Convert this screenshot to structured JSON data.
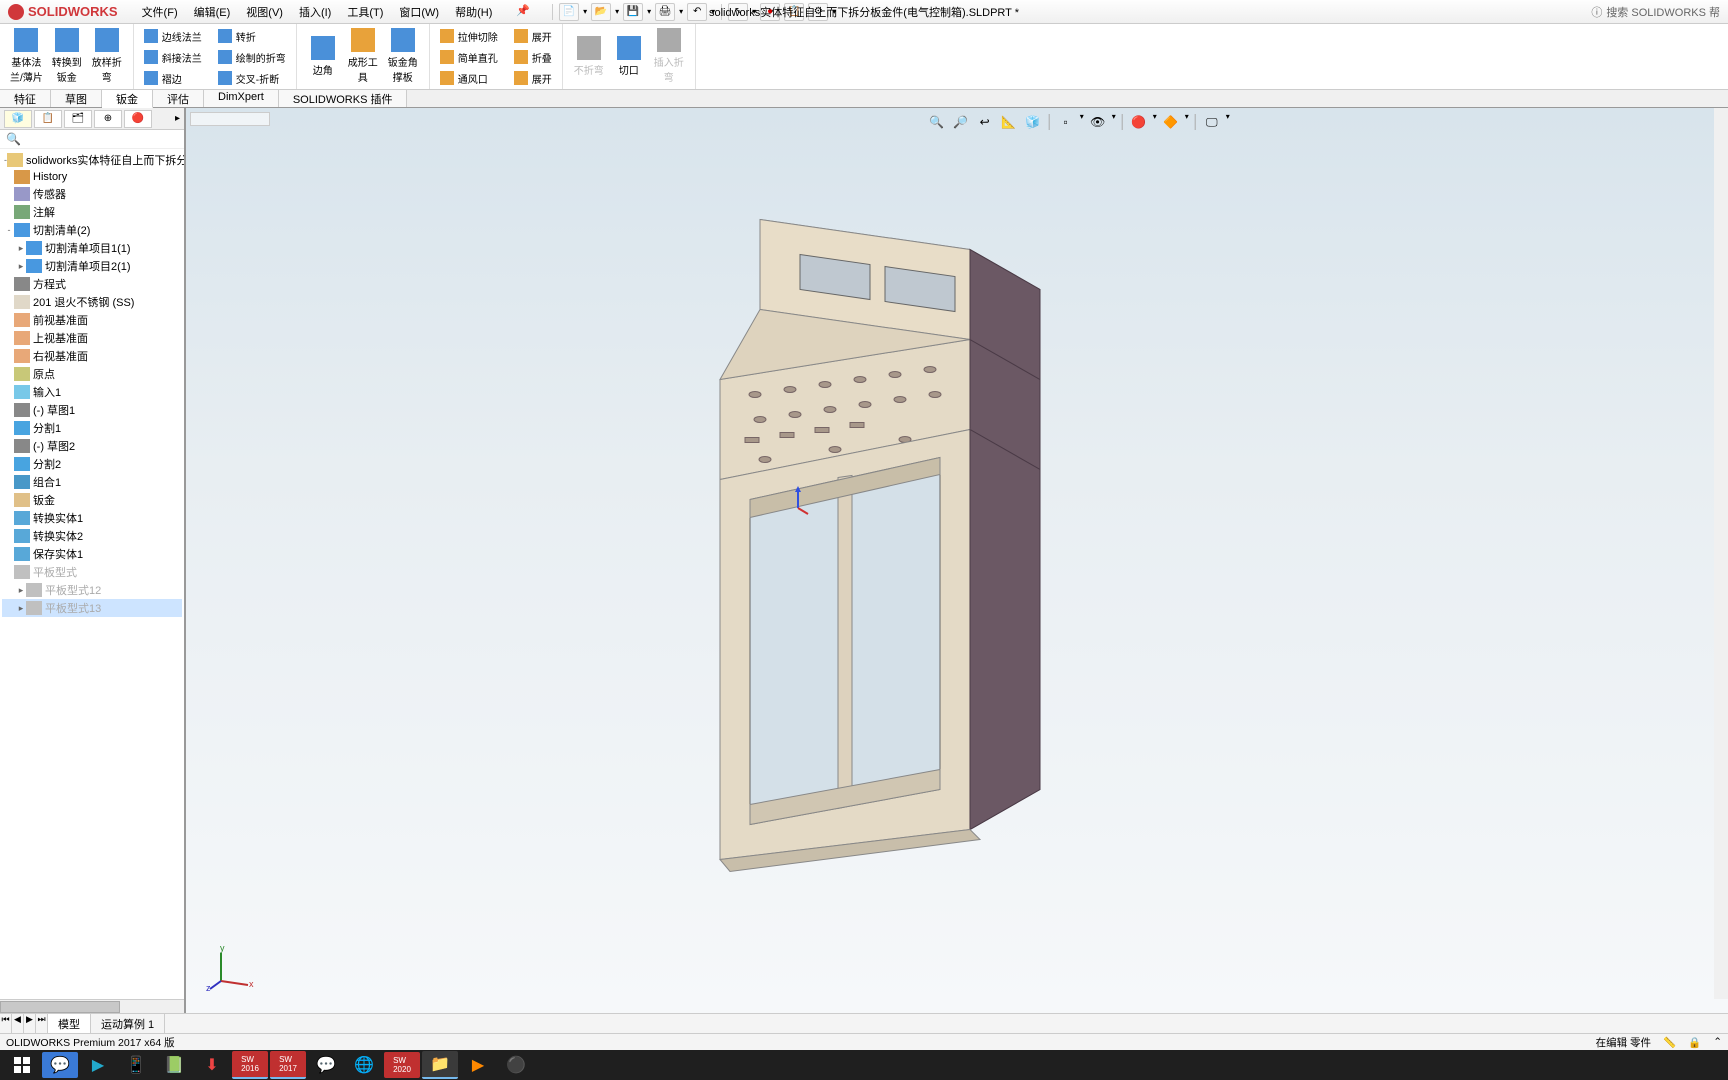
{
  "app": {
    "logo": "SOLIDWORKS",
    "doc_title": "solidworks实体特征自上而下拆分板金件(电气控制箱).SLDPRT *",
    "search_placeholder": "搜索 SOLIDWORKS 帮"
  },
  "menu": [
    "文件(F)",
    "编辑(E)",
    "视图(V)",
    "插入(I)",
    "工具(T)",
    "窗口(W)",
    "帮助(H)"
  ],
  "ribbon": {
    "large": [
      {
        "label": "基体法\n兰/薄片"
      },
      {
        "label": "转换到\n钣金"
      },
      {
        "label": "放样折\n弯"
      }
    ],
    "col1": [
      "边线法兰",
      "斜接法兰",
      "褶边"
    ],
    "col2": [
      "转折",
      "绘制的折弯",
      "交叉-折断"
    ],
    "large2": [
      {
        "label": "边角"
      },
      {
        "label": "成形工\n具"
      },
      {
        "label": "钣金角\n撑板"
      }
    ],
    "col3": [
      "拉伸切除",
      "简单直孔",
      "通风口"
    ],
    "col4": [
      "展开",
      "折叠",
      "展开"
    ],
    "large3": [
      {
        "label": "不折弯"
      },
      {
        "label": "切口"
      },
      {
        "label": "插入折\n弯"
      }
    ]
  },
  "tabs": [
    "特征",
    "草图",
    "钣金",
    "评估",
    "DimXpert",
    "SOLIDWORKS 插件"
  ],
  "tree": {
    "root": "solidworks实体特征自上而下拆分板金件",
    "items": [
      {
        "t": "History",
        "ico": "ico-hist"
      },
      {
        "t": "传感器",
        "ico": "ico-sensor"
      },
      {
        "t": "注解",
        "ico": "ico-anno"
      },
      {
        "t": "切割清单(2)",
        "ico": "ico-cutlist",
        "exp": "-"
      },
      {
        "t": "切割清单项目1(1)",
        "ico": "ico-cutlist",
        "indent": 1,
        "exp": "▸"
      },
      {
        "t": "切割清单项目2(1)",
        "ico": "ico-cutlist",
        "indent": 1,
        "exp": "▸"
      },
      {
        "t": "方程式",
        "ico": "ico-eq"
      },
      {
        "t": "201 退火不锈钢 (SS)",
        "ico": "ico-mat"
      },
      {
        "t": "前视基准面",
        "ico": "ico-plane"
      },
      {
        "t": "上视基准面",
        "ico": "ico-plane"
      },
      {
        "t": "右视基准面",
        "ico": "ico-plane"
      },
      {
        "t": "原点",
        "ico": "ico-origin"
      },
      {
        "t": "输入1",
        "ico": "ico-import"
      },
      {
        "t": "(-) 草图1",
        "ico": "ico-sketch"
      },
      {
        "t": "分割1",
        "ico": "ico-split"
      },
      {
        "t": "(-) 草图2",
        "ico": "ico-sketch"
      },
      {
        "t": "分割2",
        "ico": "ico-split"
      },
      {
        "t": "组合1",
        "ico": "ico-combine"
      },
      {
        "t": "钣金",
        "ico": "ico-sm"
      },
      {
        "t": "转换实体1",
        "ico": "ico-conv"
      },
      {
        "t": "转换实体2",
        "ico": "ico-conv"
      },
      {
        "t": "保存实体1",
        "ico": "ico-save"
      },
      {
        "t": "平板型式",
        "ico": "ico-flat",
        "gray": true
      },
      {
        "t": "平板型式12",
        "ico": "ico-flat",
        "indent": 1,
        "exp": "▸",
        "gray": true
      },
      {
        "t": "平板型式13",
        "ico": "ico-flat",
        "indent": 1,
        "exp": "▸",
        "gray": true,
        "sel": true
      }
    ]
  },
  "bottom_tabs": [
    "模型",
    "运动算例 1"
  ],
  "status": {
    "left": "OLIDWORKS Premium 2017 x64 版",
    "right": "在编辑 零件"
  },
  "triad": {
    "x": "x",
    "y": "y",
    "z": "z"
  }
}
